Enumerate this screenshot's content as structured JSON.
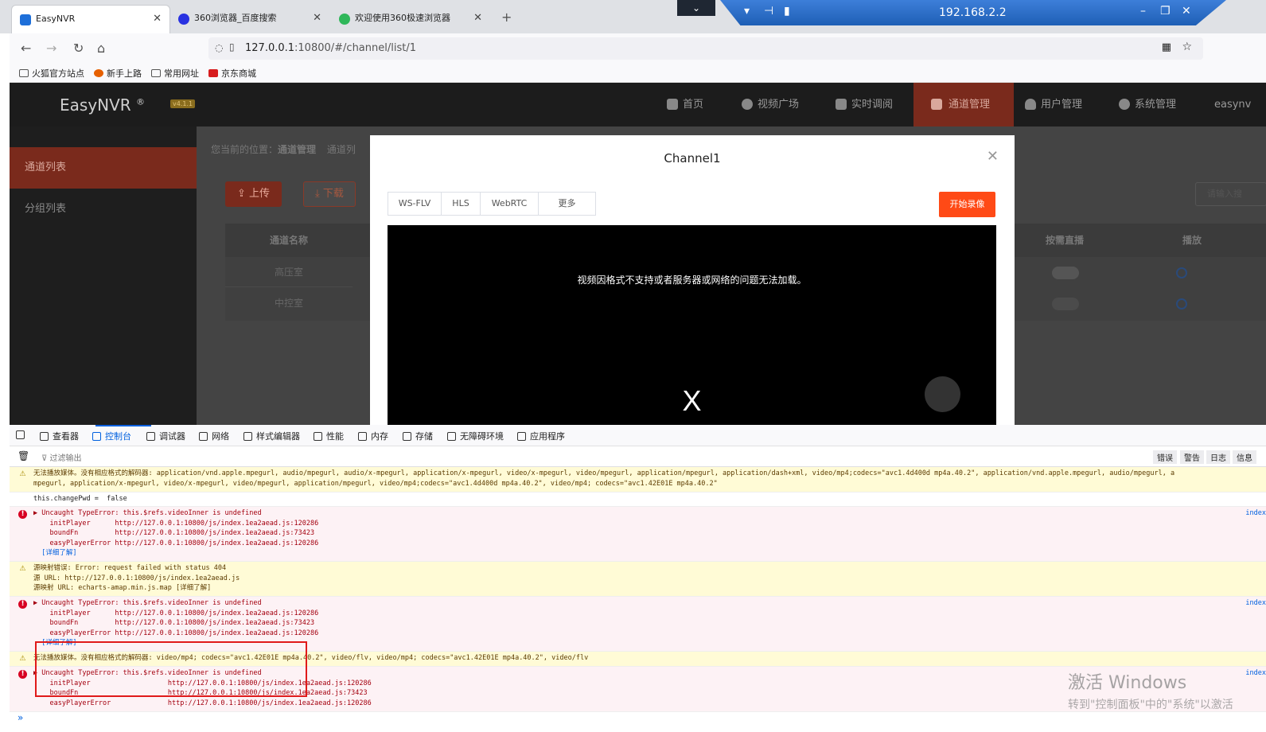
{
  "browser": {
    "tabs": [
      {
        "label": "EasyNVR",
        "icon": "easynvr-favicon",
        "color": "#1e6fd9"
      },
      {
        "label": "360浏览器_百度搜索",
        "icon": "baidu-favicon",
        "color": "#2932e1"
      },
      {
        "label": "欢迎使用360极速浏览器",
        "icon": "360-favicon",
        "color": "#2fb75a"
      }
    ],
    "new_tab": "+",
    "remote_ip": "192.168.2.2",
    "url_host": "127.0.0.1",
    "url_rest": ":10800/#/channel/list/1",
    "bookmarks": [
      "火狐官方站点",
      "新手上路",
      "常用网址",
      "京东商城"
    ]
  },
  "app": {
    "logo": "EasyNVR",
    "logo_reg": "®",
    "version": "v4.1.1",
    "menu": [
      "首页",
      "视频广场",
      "实时调阅",
      "通道管理",
      "用户管理",
      "系统管理",
      "easynv"
    ],
    "active_menu": "通道管理",
    "sidebar": [
      "通道列表",
      "分组列表"
    ],
    "breadcrumb_prefix": "您当前的位置：",
    "breadcrumb_current": "通道管理",
    "breadcrumb_next": "通道列",
    "upload": "上传",
    "download": "下载",
    "search_placeholder": "请输入搜",
    "table_headers": {
      "name": "通道名称",
      "ondemand": "按需直播",
      "play": "播放"
    },
    "rows": [
      "高压室",
      "中控室"
    ]
  },
  "modal": {
    "title": "Channel1",
    "tabs": [
      "WS-FLV",
      "HLS",
      "WebRTC",
      "更多"
    ],
    "record": "开始录像",
    "error": "视频因格式不支持或者服务器或网络的问题无法加载。",
    "close_glyph": "X"
  },
  "devtools": {
    "tools": [
      "查看器",
      "控制台",
      "调试器",
      "网络",
      "样式编辑器",
      "性能",
      "内存",
      "存储",
      "无障碍环境",
      "应用程序"
    ],
    "active_tool": "控制台",
    "filter_placeholder": "过滤输出",
    "filter_buttons": [
      "错误",
      "警告",
      "日志",
      "信息"
    ],
    "messages": [
      {
        "type": "warn",
        "lines": [
          "无法播放媒体。没有相应格式的解码器: application/vnd.apple.mpegurl, audio/mpegurl, audio/x-mpegurl, application/x-mpegurl, video/x-mpegurl, video/mpegurl, application/mpegurl, application/dash+xml, video/mp4;codecs=\"avc1.4d400d mp4a.40.2\", application/vnd.apple.mpegurl, audio/mpegurl, a",
          "mpegurl, application/x-mpegurl, video/x-mpegurl, video/mpegurl, application/mpegurl, video/mp4;codecs=\"avc1.4d400d mp4a.40.2\", video/mp4; codecs=\"avc1.42E01E mp4a.40.2\""
        ]
      },
      {
        "type": "plain",
        "lines": [
          "this.changePwd =  false"
        ]
      },
      {
        "type": "err",
        "src": "index",
        "lines": [
          "▶ Uncaught TypeError: this.$refs.videoInner is undefined",
          "    initPlayer      http://127.0.0.1:10800/js/index.1ea2aead.js:120286",
          "    boundFn         http://127.0.0.1:10800/js/index.1ea2aead.js:73423",
          "    easyPlayerError http://127.0.0.1:10800/js/index.1ea2aead.js:120286",
          "  [详细了解]"
        ]
      },
      {
        "type": "warn",
        "lines": [
          "源映射错误: Error: request failed with status 404",
          "源 URL: http://127.0.0.1:10800/js/index.1ea2aead.js",
          "源映射 URL: echarts-amap.min.js.map [详细了解]"
        ]
      },
      {
        "type": "err",
        "src": "index",
        "lines": [
          "▶ Uncaught TypeError: this.$refs.videoInner is undefined",
          "    initPlayer      http://127.0.0.1:10800/js/index.1ea2aead.js:120286",
          "    boundFn         http://127.0.0.1:10800/js/index.1ea2aead.js:73423",
          "    easyPlayerError http://127.0.0.1:10800/js/index.1ea2aead.js:120286",
          "  [详细了解]"
        ]
      },
      {
        "type": "warn",
        "lines": [
          "无法播放媒体。没有相应格式的解码器: video/mp4; codecs=\"avc1.42E01E mp4a.40.2\", video/flv, video/mp4; codecs=\"avc1.42E01E mp4a.40.2\", video/flv"
        ]
      },
      {
        "type": "err",
        "src": "index",
        "lines": [
          "▶ Uncaught TypeError: this.$refs.videoInner is undefined",
          "    initPlayer                   http://127.0.0.1:10800/js/index.1ea2aead.js:120286",
          "    boundFn                      http://127.0.0.1:10800/js/index.1ea2aead.js:73423",
          "    easyPlayerError              http://127.0.0.1:10800/js/index.1ea2aead.js:120286"
        ]
      }
    ],
    "prompt": "»"
  },
  "watermark": {
    "line1": "激活 Windows",
    "line2": "转到\"控制面板\"中的\"系统\"以激活"
  }
}
